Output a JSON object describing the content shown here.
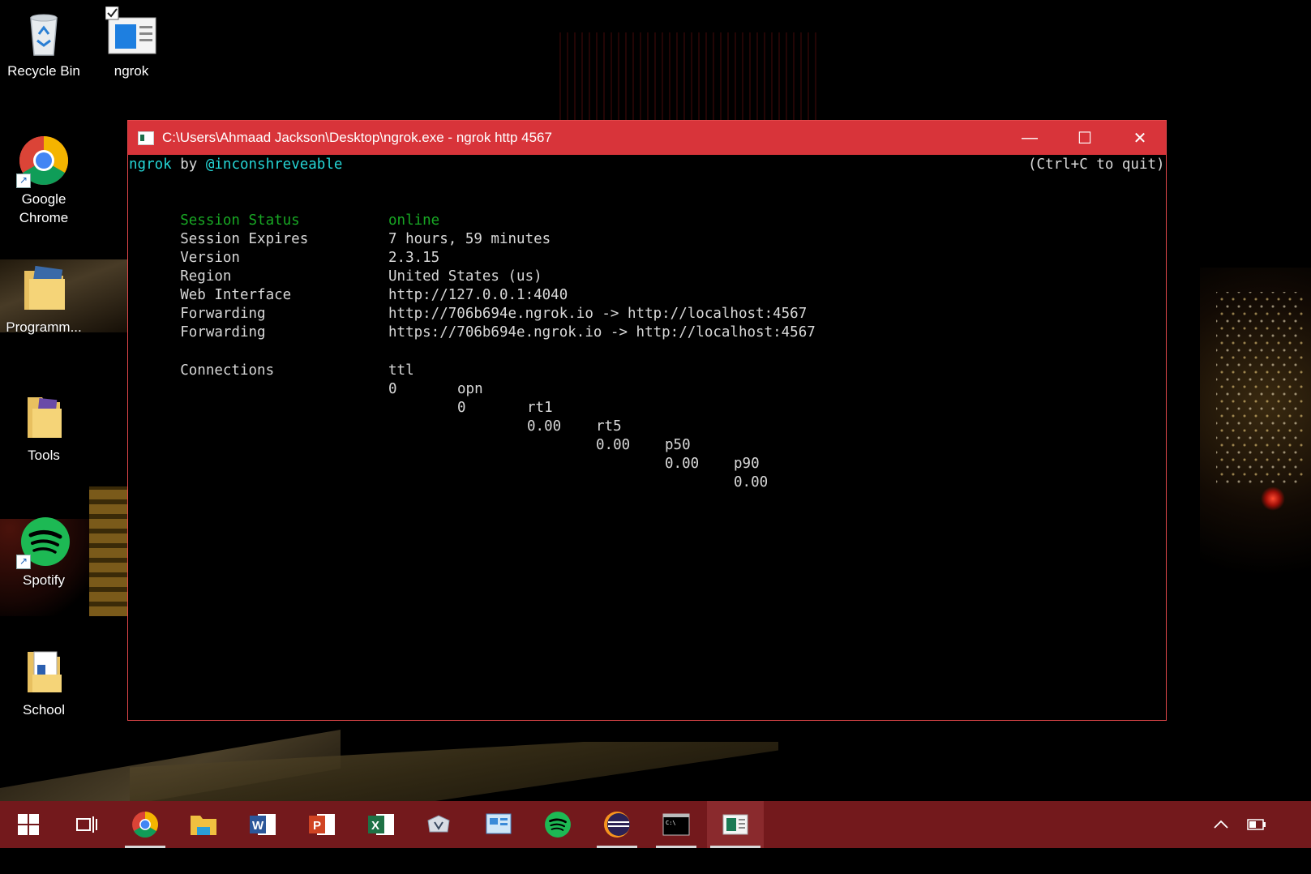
{
  "desktop": {
    "icons": [
      {
        "label": "Recycle Bin",
        "icon": "recycle-bin-icon"
      },
      {
        "label": "ngrok",
        "icon": "ngrok-app-icon"
      },
      {
        "label": "Google Chrome",
        "icon": "chrome-icon"
      },
      {
        "label": "Programm...",
        "icon": "folder-icon"
      },
      {
        "label": "Tools",
        "icon": "folder-icon"
      },
      {
        "label": "Spotify",
        "icon": "spotify-icon"
      },
      {
        "label": "School",
        "icon": "folder-icon"
      }
    ]
  },
  "window": {
    "title": "C:\\Users\\Ahmaad Jackson\\Desktop\\ngrok.exe - ngrok  http 4567",
    "controls": {
      "minimize": "—",
      "maximize": "☐",
      "close": "✕"
    }
  },
  "console": {
    "header_left_1": "ngrok",
    "header_left_2": " by ",
    "header_left_3": "@inconshreveable",
    "header_right": "(Ctrl+C to quit)",
    "rows": [
      {
        "key": "Session Status",
        "value": "online"
      },
      {
        "key": "Session Expires",
        "value": "7 hours, 59 minutes"
      },
      {
        "key": "Version",
        "value": "2.3.15"
      },
      {
        "key": "Region",
        "value": "United States (us)"
      },
      {
        "key": "Web Interface",
        "value": "http://127.0.0.1:4040"
      },
      {
        "key": "Forwarding",
        "value": "http://706b694e.ngrok.io -> http://localhost:4567"
      },
      {
        "key": "Forwarding",
        "value": "https://706b694e.ngrok.io -> http://localhost:4567"
      }
    ],
    "connections_label": "Connections",
    "connections_headers": [
      "ttl",
      "opn",
      "rt1",
      "rt5",
      "p50",
      "p90"
    ],
    "connections_values": [
      "0",
      "0",
      "0.00",
      "0.00",
      "0.00",
      "0.00"
    ]
  },
  "taskbar": {
    "items": [
      "start-icon",
      "task-view-icon",
      "chrome-icon",
      "file-explorer-icon",
      "word-icon",
      "powerpoint-icon",
      "excel-icon",
      "app-icon",
      "control-panel-icon",
      "spotify-icon",
      "eclipse-icon",
      "command-prompt-icon",
      "ngrok-app-icon"
    ],
    "tray": [
      "chevron-up-icon",
      "battery-icon"
    ]
  },
  "colors": {
    "titlebar": "#d8343a",
    "taskbar": "#73191c",
    "accent_cyan": "#25d6d6",
    "status_green": "#18a824"
  }
}
